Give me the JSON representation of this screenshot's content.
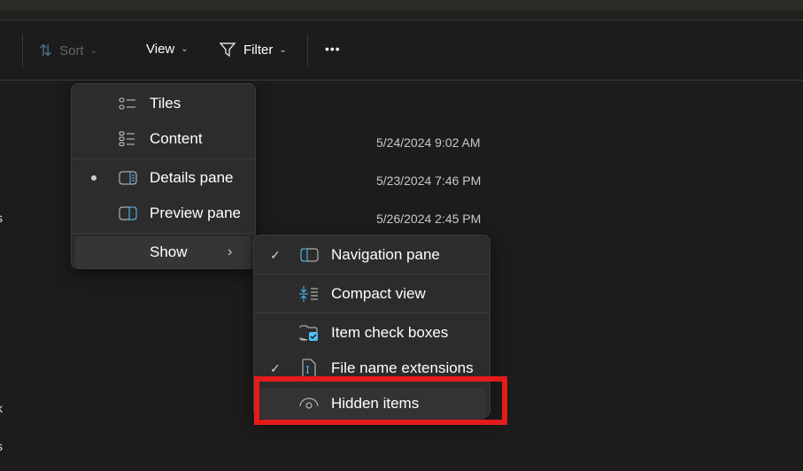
{
  "toolbar": {
    "sort_label": "Sort",
    "view_label": "View",
    "filter_label": "Filter",
    "more_label": "•••"
  },
  "file_list": {
    "dates": [
      "5/24/2024 9:02 AM",
      "5/23/2024 7:46 PM",
      "5/26/2024 2:45 PM"
    ],
    "left_fragments": [
      ".",
      "s",
      "k",
      "s"
    ]
  },
  "view_menu": {
    "items": [
      {
        "label": "Tiles",
        "icon": "tiles-icon"
      },
      {
        "label": "Content",
        "icon": "content-icon"
      },
      {
        "label": "Details pane",
        "icon": "details-pane-icon",
        "selected": true
      },
      {
        "label": "Preview pane",
        "icon": "preview-pane-icon"
      },
      {
        "label": "Show",
        "icon": "chevron-right-icon"
      }
    ]
  },
  "show_menu": {
    "items": [
      {
        "label": "Navigation pane",
        "icon": "navigation-pane-icon",
        "checked": true
      },
      {
        "label": "Compact view",
        "icon": "compact-view-icon",
        "checked": false
      },
      {
        "label": "Item check boxes",
        "icon": "item-check-boxes-icon",
        "checked": false
      },
      {
        "label": "File name extensions",
        "icon": "file-extension-icon",
        "checked": true
      },
      {
        "label": "Hidden items",
        "icon": "eye-icon",
        "checked": false
      }
    ]
  },
  "colors": {
    "accent": "#4cc2ff",
    "highlight_box": "#e31b1b",
    "menu_bg": "#2c2c2c",
    "background": "#1c1c1c"
  }
}
